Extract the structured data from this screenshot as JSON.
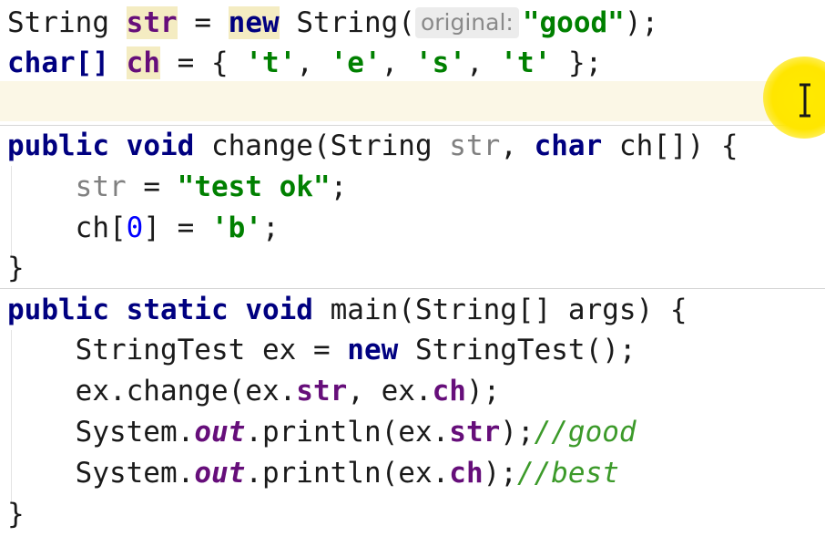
{
  "editor": {
    "lines": [
      {
        "tokens": [
          "String ",
          "str",
          " = ",
          "new",
          " String(",
          "original:",
          " ",
          "\"good\"",
          ");"
        ]
      },
      {
        "tokens": [
          "char[] ",
          "ch",
          " = { ",
          "'t'",
          ", ",
          "'e'",
          ", ",
          "'s'",
          ", ",
          "'t'",
          " };"
        ]
      },
      {
        "tokens": [
          ""
        ]
      },
      {
        "tokens": [
          "public",
          " ",
          "void",
          " change(String ",
          "str",
          ", ",
          "char",
          " ch[]) {"
        ]
      },
      {
        "tokens": [
          "    ",
          "str",
          " = ",
          "\"test ok\"",
          ";"
        ]
      },
      {
        "tokens": [
          "    ch[",
          "0",
          "] = ",
          "'b'",
          ";"
        ]
      },
      {
        "tokens": [
          "}"
        ]
      },
      {
        "tokens": [
          "public",
          " ",
          "static",
          " ",
          "void",
          " main(String[] args) {"
        ]
      },
      {
        "tokens": [
          "    StringTest ex = ",
          "new",
          " StringTest();"
        ]
      },
      {
        "tokens": [
          "    ex.change(ex.",
          "str",
          ", ex.",
          "ch",
          ");"
        ]
      },
      {
        "tokens": [
          "    System.",
          "out",
          ".println(ex.",
          "str",
          ");",
          "//good"
        ]
      },
      {
        "tokens": [
          "    System.",
          "out",
          ".println(ex.",
          "ch",
          ");",
          "//best"
        ]
      },
      {
        "tokens": [
          "}"
        ]
      }
    ]
  },
  "icons": {
    "cursor": "i-beam-cursor-icon",
    "cursor_highlight_color": "#ffe600"
  }
}
